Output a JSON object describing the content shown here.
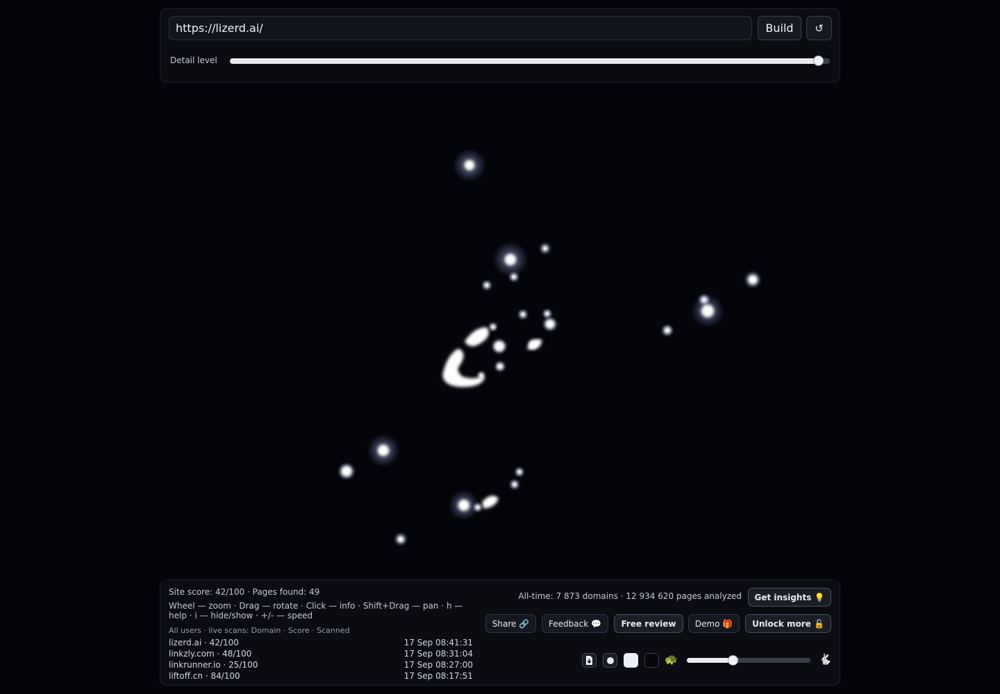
{
  "controls": {
    "url_value": "https://lizerd.ai/",
    "build_label": "Build",
    "reset_icon": "refresh-icon",
    "reset_glyph": "↺",
    "detail_label": "Detail level",
    "detail_level": 0.98
  },
  "graph": {
    "node_color": "#ffffff",
    "glow_color": "#c8d2ff"
  },
  "info": {
    "site_stats": "Site score: 42/100 · Pages found: 49",
    "help_text": "Wheel — zoom · Drag — rotate · Click — info · Shift+Drag — pan · h — help · i — hide/show · +/- — speed",
    "scans_header": "All users · live scans: Domain · Score · Scanned",
    "scans": [
      {
        "domain": "lizerd.ai · 42/100",
        "time": "17 Sep 08:41:31"
      },
      {
        "domain": "linkzly.com · 48/100",
        "time": "17 Sep 08:31:04"
      },
      {
        "domain": "linkrunner.io · 25/100",
        "time": "17 Sep 08:27:00"
      },
      {
        "domain": "liftoff.cn · 84/100",
        "time": "17 Sep 08:17:51"
      }
    ],
    "alltime": "All-time: 7 873 domains · 12 934 620 pages analyzed",
    "insights_label": "Get insights 💡",
    "share_label": "Share 🔗",
    "feedback_label": "Feedback 💬",
    "free_review_label": "Free review",
    "demo_label": "Demo 🎁",
    "unlock_label": "Unlock more 🔓",
    "download_icon": "download-icon",
    "dot_icon": "dot-icon",
    "turtle_icon": "🐢",
    "rabbit_icon": "🐇",
    "speed_level": 0.37
  }
}
